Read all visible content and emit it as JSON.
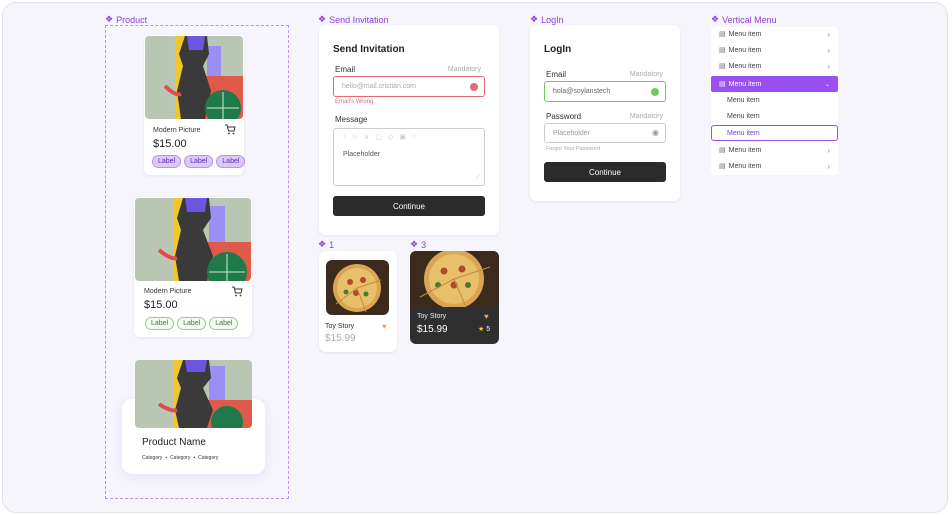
{
  "frames": {
    "product": "Product",
    "send_invitation": "Send Invitation",
    "login": "LogIn",
    "vertical_menu": "Vertical Menu",
    "food1": "1",
    "food3": "3"
  },
  "product_cards": [
    {
      "title": "Modern Picture",
      "price": "$15.00",
      "labels": [
        "Label",
        "Label",
        "Label"
      ]
    },
    {
      "title": "Modern Picture",
      "price": "$15.00",
      "labels": [
        "Label",
        "Label",
        "Label"
      ]
    }
  ],
  "product_name_card": {
    "title": "Product Name",
    "categories": [
      "Category",
      "Category",
      "Category"
    ]
  },
  "send_invitation": {
    "title": "Send Invitation",
    "email_label": "Email",
    "mandatory": "Mandatory",
    "email_placeholder": "hello@mail.cristian.com",
    "error": "Email's Wrong",
    "message_label": "Message",
    "message_placeholder": "Placeholder",
    "button": "Continue"
  },
  "login": {
    "title": "LogIn",
    "email_label": "Email",
    "email_mandatory": "Mandatory",
    "email_value": "hola@soylanstech",
    "password_label": "Password",
    "password_mandatory": "Mandatory",
    "password_placeholder": "Placeholder",
    "forgot": "Forgot Your Password",
    "button": "Continue"
  },
  "vertical_menu": {
    "items": [
      "Menu item",
      "Menu item",
      "Menu item",
      "Menu item",
      "Menu item",
      "Menu item",
      "Menu item",
      "Menu item",
      "Menu item"
    ]
  },
  "food_cards": [
    {
      "title": "Toy Story",
      "price": "$15.99"
    },
    {
      "title": "Toy Story",
      "price": "$15.99",
      "rating": "5"
    }
  ],
  "colors": {
    "accent": "#8b3fd9",
    "menu_active": "#9a4ff0",
    "error": "#e06b79",
    "success": "#6fca5c",
    "dark": "#2b2b2b"
  },
  "icons": [
    "diamond-icon",
    "cart-icon",
    "error-icon",
    "check-icon",
    "eye-icon",
    "menu-item-icon",
    "chevron-right-icon",
    "chevron-down-icon",
    "heart-icon",
    "star-icon"
  ]
}
